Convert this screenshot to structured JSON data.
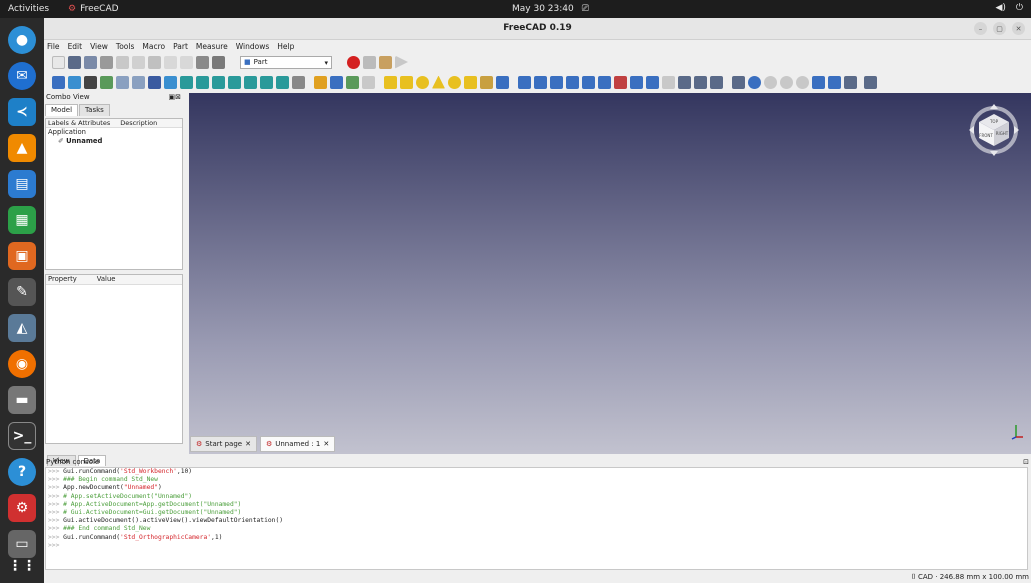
{
  "topbar": {
    "activities": "Activities",
    "app_name": "FreeCAD",
    "datetime": "May 30  23:40"
  },
  "window": {
    "title": "FreeCAD 0.19"
  },
  "menu": [
    "File",
    "Edit",
    "View",
    "Tools",
    "Macro",
    "Part",
    "Measure",
    "Windows",
    "Help"
  ],
  "workbench": {
    "selected": "Part"
  },
  "combo_view": {
    "title": "Combo View",
    "tabs": [
      "Model",
      "Tasks"
    ],
    "tree_columns": [
      "Labels & Attributes",
      "Description"
    ],
    "tree_root": "Application",
    "tree_doc": "Unnamed",
    "property_columns": [
      "Property",
      "Value"
    ],
    "bottom_tabs": [
      "View",
      "Data"
    ]
  },
  "doc_tabs": [
    {
      "label": "Start page"
    },
    {
      "label": "Unnamed : 1"
    }
  ],
  "navcube": {
    "top": "TOP",
    "front": "FRONT",
    "right": "RIGHT"
  },
  "python_console": {
    "title": "Python console",
    "lines": [
      {
        "p": ">>> ",
        "a": "Gui.runCommand(",
        "s": "'Std_Workbench'",
        "b": ",10)"
      },
      {
        "p": ">>> ",
        "c": "### Begin command Std_New"
      },
      {
        "p": ">>> ",
        "a": "App.newDocument(",
        "s": "\"Unnamed\"",
        "b": ")"
      },
      {
        "p": ">>> ",
        "c": "# App.setActiveDocument(\"Unnamed\")"
      },
      {
        "p": ">>> ",
        "c": "# App.ActiveDocument=App.getDocument(\"Unnamed\")"
      },
      {
        "p": ">>> ",
        "c": "# Gui.ActiveDocument=Gui.getDocument(\"Unnamed\")"
      },
      {
        "p": ">>> ",
        "a": "Gui.activeDocument().activeView().viewDefaultOrientation()"
      },
      {
        "p": ">>> ",
        "c": "### End command Std_New"
      },
      {
        "p": ">>> ",
        "a": "Gui.runCommand(",
        "s": "'Std_OrthographicCamera'",
        "b": ",1)"
      },
      {
        "p": ">>> "
      }
    ]
  },
  "status": {
    "text": "CAD  ·  246.88 mm x 100.00 mm"
  },
  "colors": {
    "accent": "#1f6fd0",
    "record": "#d42020"
  }
}
